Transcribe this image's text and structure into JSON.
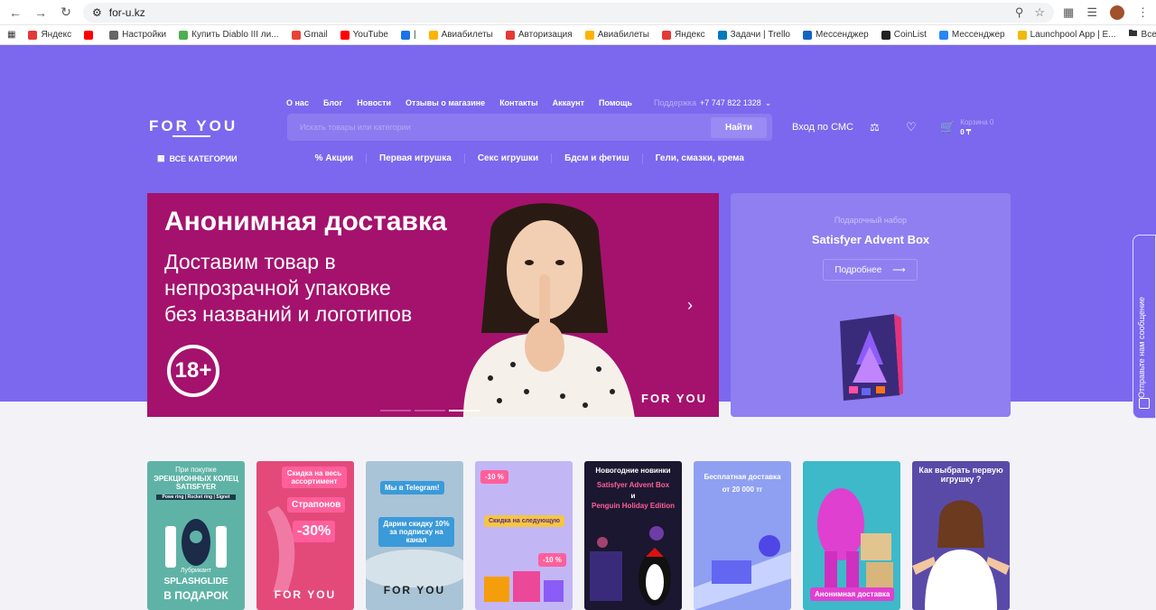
{
  "browser": {
    "url": "for-u.kz",
    "bookmarks": [
      {
        "label": "Яндекс",
        "color": "#e53935"
      },
      {
        "label": "",
        "color": "#ff0000"
      },
      {
        "label": "Настройки",
        "color": "#666666"
      },
      {
        "label": "Купить Diablo III ли...",
        "color": "#4caf50"
      },
      {
        "label": "Gmail",
        "color": "#ea4335"
      },
      {
        "label": "YouTube",
        "color": "#ff0000"
      },
      {
        "label": "|",
        "color": "#1a73e8"
      },
      {
        "label": "Авиабилеты",
        "color": "#ffb300"
      },
      {
        "label": "Авторизация",
        "color": "#e53935"
      },
      {
        "label": "Авиабилеты",
        "color": "#ffb300"
      },
      {
        "label": "Яндекс",
        "color": "#e53935"
      },
      {
        "label": "Задачи | Trello",
        "color": "#0079bf"
      },
      {
        "label": "Мессенджер",
        "color": "#1565c0"
      },
      {
        "label": "CoinList",
        "color": "#222222"
      },
      {
        "label": "Мессенджер",
        "color": "#2787f5"
      },
      {
        "label": "Launchpool App | E...",
        "color": "#f0b90b"
      }
    ],
    "bookmarks_folder": "Все закладки"
  },
  "site": {
    "logo": "FOR YOU",
    "top_nav": [
      "О нас",
      "Блог",
      "Новости",
      "Отзывы о магазине",
      "Контакты",
      "Аккаунт",
      "Помощь"
    ],
    "phone_label": "Поддержка",
    "phone": "+7 747 822 1328",
    "search_placeholder": "Искать товары или категории",
    "search_button": "Найти",
    "login": "Вход по СМС",
    "cart_label": "Корзина 0",
    "cart_total": "0 ₸",
    "all_categories": "ВСЕ КАТЕГОРИИ",
    "categories": [
      "Акции",
      "Первая игрушка",
      "Секс игрушки",
      "Бдсм и фетиш",
      "Гели, смазки, крема"
    ]
  },
  "banner": {
    "title": "Анонимная доставка",
    "line1": "Доставим товар в",
    "line2": "непрозрачной упаковке",
    "line3": "без названий и логотипов",
    "age": "18+",
    "brand": "FOR YOU"
  },
  "promo": {
    "caption": "Подарочный набор",
    "title": "Satisfyer Advent Box",
    "button": "Подробнее"
  },
  "chat_widget": "Отправьте нам сообщение",
  "stories": [
    {
      "bg": "#5fb3a6",
      "top": "При покупке",
      "mid": "ЭРЕКЦИОННЫХ КОЛЕЦ SATISFYER",
      "extra": "Powe ring | Rocket ring | Signet",
      "bottom1": "Лубрикант",
      "bottom2": "SPLASHGLIDE",
      "bottom3": "В ПОДАРОК"
    },
    {
      "bg": "#e34a7a",
      "tag1": "Скидка на весь ассортимент",
      "tag2": "Страпонов",
      "tag3": "-30%",
      "bottom": "FOR YOU"
    },
    {
      "bg": "#a9c4d6",
      "tag1": "Мы в Telegram!",
      "tag2": "Дарим скидку 10% за подписку на канал",
      "bottom": "FOR YOU"
    },
    {
      "bg": "#c3b6f5",
      "tag1": "-10 %",
      "tag2": "Скидка на следующую",
      "tag3": "-10 %"
    },
    {
      "bg": "#1b1730",
      "tag1": "Новогодние новинки",
      "tag2": "Satisfyer Advent Box",
      "tag3": "и",
      "tag4": "Penguin Holiday Edition"
    },
    {
      "bg": "#8f9ff2",
      "tag1": "Бесплатная доставка",
      "tag2": "от 20 000 тг"
    },
    {
      "bg": "#3db9c9",
      "tag1": "Анонимная доставка"
    },
    {
      "bg": "#5a4aa8",
      "tag1": "Как выбрать первую игрушку ?"
    }
  ]
}
